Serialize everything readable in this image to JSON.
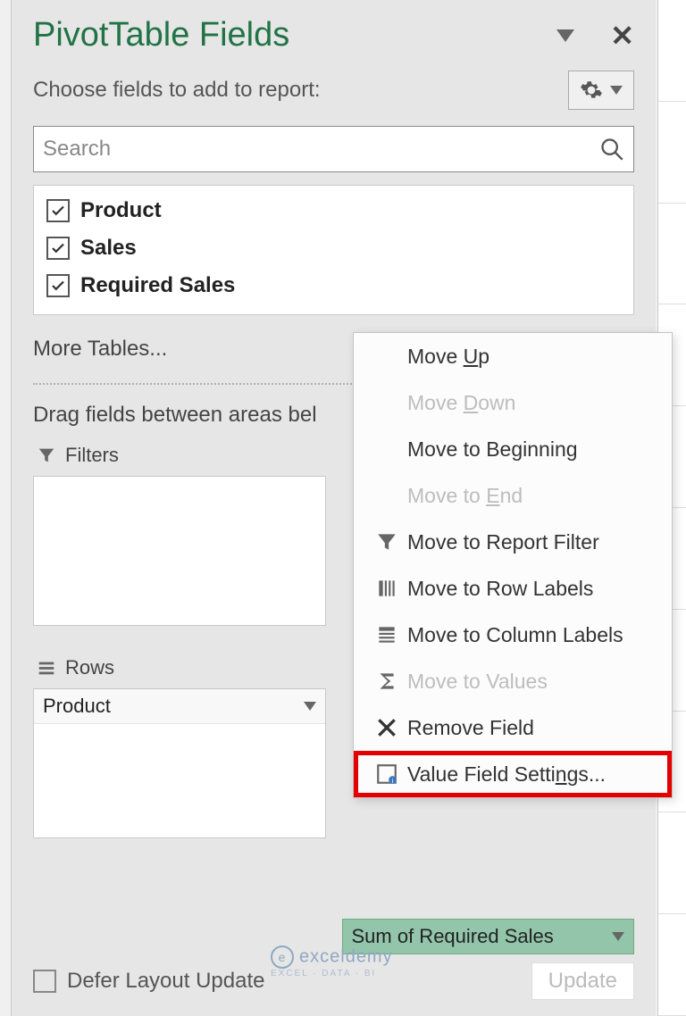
{
  "header": {
    "title": "PivotTable Fields",
    "subtitle": "Choose fields to add to report:"
  },
  "search": {
    "placeholder": "Search"
  },
  "fields": {
    "items": [
      {
        "label": "Product",
        "checked": true
      },
      {
        "label": "Sales",
        "checked": true
      },
      {
        "label": "Required Sales",
        "checked": true
      }
    ],
    "more_label": "More Tables..."
  },
  "drag_label": "Drag fields between areas bel",
  "areas": {
    "filters_label": "Filters",
    "rows_label": "Rows",
    "rows_item": "Product",
    "values_item": "Sum of Required Sales"
  },
  "context_menu": {
    "items": [
      {
        "label_pre": "Move ",
        "key": "U",
        "label_post": "p",
        "icon": "",
        "disabled": false
      },
      {
        "label_pre": "Move ",
        "key": "D",
        "label_post": "own",
        "icon": "",
        "disabled": true
      },
      {
        "label_pre": "Move to Be",
        "key": "g",
        "label_post": "inning",
        "icon": "",
        "disabled": false
      },
      {
        "label_pre": "Move to ",
        "key": "E",
        "label_post": "nd",
        "icon": "",
        "disabled": true
      },
      {
        "label_pre": "Move to Report Filter",
        "key": "",
        "label_post": "",
        "icon": "filter",
        "disabled": false
      },
      {
        "label_pre": "Move to Row Labels",
        "key": "",
        "label_post": "",
        "icon": "rows",
        "disabled": false
      },
      {
        "label_pre": "Move to Column Labels",
        "key": "",
        "label_post": "",
        "icon": "cols",
        "disabled": false
      },
      {
        "label_pre": "Move to Values",
        "key": "",
        "label_post": "",
        "icon": "sigma",
        "disabled": true
      },
      {
        "label_pre": "Remove Field",
        "key": "",
        "label_post": "",
        "icon": "remove",
        "disabled": false
      },
      {
        "label_pre": "Value Field Setti",
        "key": "n",
        "label_post": "gs...",
        "icon": "settings",
        "disabled": false,
        "highlight": true
      }
    ]
  },
  "footer": {
    "defer_label": "Defer Layout Update",
    "update_label": "Update"
  },
  "watermark": {
    "brand": "exceldemy",
    "tag": "EXCEL · DATA · BI"
  }
}
